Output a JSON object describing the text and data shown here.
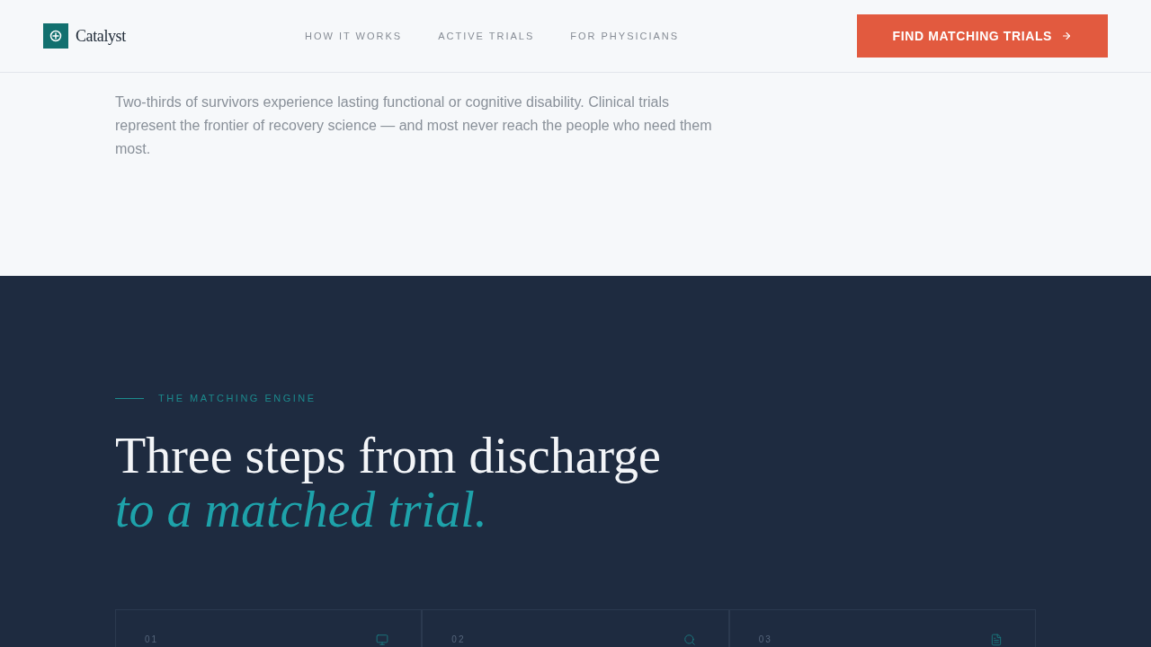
{
  "header": {
    "brand": "Catalyst",
    "nav": [
      {
        "label": "HOW IT WORKS"
      },
      {
        "label": "ACTIVE TRIALS"
      },
      {
        "label": "FOR PHYSICIANS"
      }
    ],
    "cta": {
      "label": "FIND MATCHING TRIALS"
    }
  },
  "intro": {
    "text": "Two-thirds of survivors experience lasting functional or cognitive disability. Clinical trials represent the frontier of recovery science — and most never reach the people who need them most."
  },
  "matching": {
    "eyebrow": "THE MATCHING ENGINE",
    "title": "Three steps from discharge",
    "title_accent": "to a matched trial.",
    "steps": [
      {
        "number": "01",
        "kind": "monitor"
      },
      {
        "number": "02",
        "kind": "search"
      },
      {
        "number": "03",
        "kind": "document"
      }
    ]
  }
}
